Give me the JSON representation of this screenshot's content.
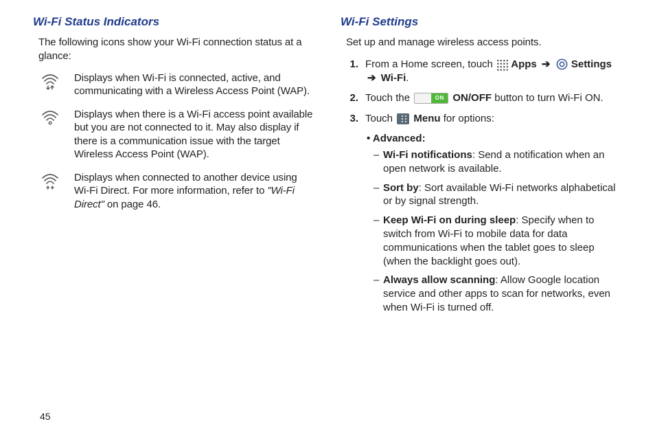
{
  "page_number": "45",
  "left": {
    "heading": "Wi-Fi Status Indicators",
    "intro": "The following icons show your Wi-Fi connection status at a glance:",
    "rows": [
      {
        "icon": "wifi-active-icon",
        "text": "Displays when Wi-Fi is connected, active, and communicating with a Wireless Access Point (WAP)."
      },
      {
        "icon": "wifi-available-icon",
        "text": "Displays when there is a Wi-Fi access point available but you are not connected to it. May also display if there is a communication issue with the target Wireless Access Point (WAP)."
      },
      {
        "icon": "wifi-direct-icon",
        "text_prefix": "Displays when connected to another device using Wi-Fi Direct. For more information, refer to ",
        "ref": "\"Wi-Fi Direct\"",
        "text_suffix": " on page 46."
      }
    ]
  },
  "right": {
    "heading": "Wi-Fi Settings",
    "intro": "Set up and manage wireless access points.",
    "step1_a": "From a Home screen, touch ",
    "apps_label": "Apps",
    "settings_label": "Settings",
    "wifi_label": "Wi-Fi",
    "step2_a": "Touch the ",
    "toggle_on": "ON",
    "step2_b": "ON/OFF",
    "step2_c": " button to turn Wi-Fi ON.",
    "step3_a": "Touch ",
    "menu_label": "Menu",
    "step3_b": " for options:",
    "advanced_label": "Advanced:",
    "advanced": [
      {
        "term": "Wi-Fi notifications",
        "def": ": Send a notification when an open network is available."
      },
      {
        "term": "Sort by",
        "def": ": Sort available Wi-Fi networks alphabetical or by signal strength."
      },
      {
        "term": "Keep Wi-Fi on during sleep",
        "def": ": Specify when to switch from Wi-Fi to mobile data for data communications when the tablet goes to sleep (when the backlight goes out)."
      },
      {
        "term": "Always allow scanning",
        "def": ": Allow Google location service and other apps to scan for networks, even when Wi-Fi is turned off."
      }
    ]
  }
}
